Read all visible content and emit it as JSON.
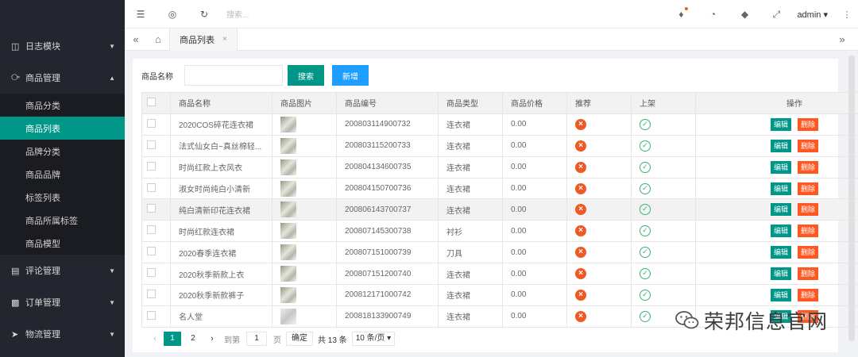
{
  "sidebar": {
    "groups": [
      {
        "label": "日志模块",
        "icon": "car-icon"
      },
      {
        "label": "商品管理",
        "icon": "cube-icon"
      }
    ],
    "items": [
      "商品分类",
      "商品列表",
      "品牌分类",
      "商品品牌",
      "标签列表",
      "商品所属标签",
      "商品模型"
    ],
    "active_item": "商品列表",
    "groups_bottom": [
      {
        "label": "评论管理",
        "icon": "comment-icon"
      },
      {
        "label": "订单管理",
        "icon": "order-icon"
      },
      {
        "label": "物流管理",
        "icon": "truck-icon"
      }
    ]
  },
  "topbar": {
    "search_placeholder": "搜索...",
    "user": "admin"
  },
  "tabs": {
    "current": "商品列表",
    "close": "×"
  },
  "filter": {
    "label": "商品名称",
    "input_value": "",
    "search_button": "搜索",
    "add_button": "新增"
  },
  "table": {
    "headers": [
      "商品名称",
      "商品图片",
      "商品编号",
      "商品类型",
      "商品价格",
      "推荐",
      "上架",
      "操作"
    ],
    "edit_label": "编辑",
    "delete_label": "删除",
    "rows": [
      {
        "name": "2020COS碎花连衣裙",
        "code": "200803114900732",
        "type": "连衣裙",
        "price": "0.00"
      },
      {
        "name": "法式仙女白~真丝棉轻...",
        "code": "200803115200733",
        "type": "连衣裙",
        "price": "0.00"
      },
      {
        "name": "时尚红款上衣风衣",
        "code": "200804134600735",
        "type": "连衣裙",
        "price": "0.00"
      },
      {
        "name": "淑女时尚纯白小清新",
        "code": "200804150700736",
        "type": "连衣裙",
        "price": "0.00"
      },
      {
        "name": "纯白清新印花连衣裙",
        "code": "200806143700737",
        "type": "连衣裙",
        "price": "0.00"
      },
      {
        "name": "时尚红款连衣裙",
        "code": "200807145300738",
        "type": "衬衫",
        "price": "0.00"
      },
      {
        "name": "2020春季连衣裙",
        "code": "200807151000739",
        "type": "刀具",
        "price": "0.00"
      },
      {
        "name": "2020秋季新款上衣",
        "code": "200807151200740",
        "type": "连衣裙",
        "price": "0.00"
      },
      {
        "name": "2020秋季新款裤子",
        "code": "200812171000742",
        "type": "连衣裙",
        "price": "0.00"
      },
      {
        "name": "名人堂",
        "code": "200818133900749",
        "type": "连衣裙",
        "price": "0.00"
      }
    ]
  },
  "pagination": {
    "prev": "‹",
    "current_page": "1",
    "page_2": "2",
    "next": "›",
    "goto_label": "到第",
    "goto_value": "1",
    "page_unit": "页",
    "confirm": "确定",
    "total": "共 13 条",
    "page_size": "10 条/页"
  },
  "watermark": {
    "text": "荣邦信息官网"
  },
  "colors": {
    "sidebar_bg": "#23262e",
    "accent": "#009688",
    "blue": "#1e9fff",
    "danger": "#ff5722"
  }
}
